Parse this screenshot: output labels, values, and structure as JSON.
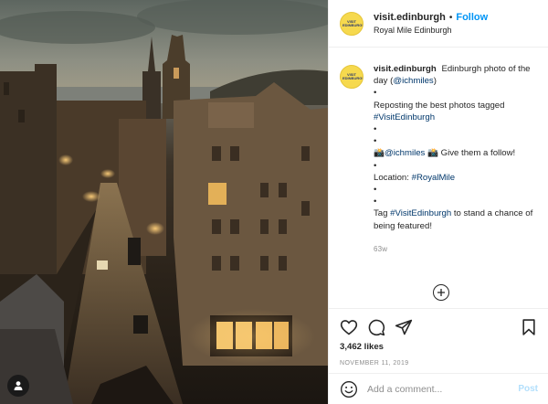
{
  "post": {
    "username": "visit.edinburgh",
    "separator": "•",
    "follow_label": "Follow",
    "location": "Royal Mile Edinburgh",
    "avatar_text": "VISIT EDINBURGH"
  },
  "caption": {
    "username": "visit.edinburgh",
    "line1": "Edinburgh photo of the day (",
    "mention1": "@ichmiles",
    "line1_end": ")",
    "bullet": "•",
    "reposting": "Reposting the best photos tagged",
    "hashtag1": "#VisitEdinburgh",
    "camera_emoji": "📸",
    "mention2": "@ichmiles",
    "give_follow": "Give them a follow!",
    "location_label": "Location: ",
    "hashtag2": "#RoyalMile",
    "tag_prefix": "Tag ",
    "hashtag3": "#VisitEdinburgh",
    "tag_suffix": " to stand a chance of being featured!",
    "age": "63w"
  },
  "engagement": {
    "likes": "3,462 likes",
    "date": "NOVEMBER 11, 2019"
  },
  "comment_box": {
    "placeholder": "Add a comment...",
    "post_label": "Post"
  },
  "icons": {
    "tag": "person-tag-icon",
    "heart": "heart-icon",
    "comment": "comment-icon",
    "share": "paper-plane-icon",
    "bookmark": "bookmark-icon",
    "emoji": "smiley-icon",
    "load_more": "plus-circle-icon"
  },
  "colors": {
    "follow_blue": "#0095f6",
    "link_navy": "#00376b",
    "muted_grey": "#8e8e8e",
    "post_disabled": "#b2dffc",
    "avatar_yellow": "#f6d94e"
  }
}
